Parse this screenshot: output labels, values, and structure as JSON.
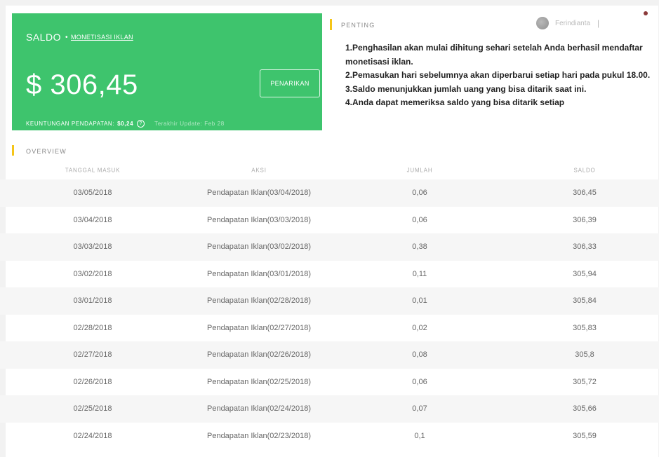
{
  "saldo": {
    "label": "SALDO",
    "bullet": "•",
    "link": "MONETISASI IKLAN",
    "amount": "$ 306,45",
    "withdraw_label": "PENARIKAN",
    "profit_label": "KEUNTUNGAN PENDAPATAN:",
    "profit_value": "$0,24",
    "updated": "Terakhir Update: Feb 28"
  },
  "notice": {
    "title": "PENTING",
    "lines": [
      "1.Penghasilan akan mulai dihitung sehari setelah Anda berhasil mendaftar monetisasi iklan.",
      "2.Pemasukan hari sebelumnya akan diperbarui setiap hari pada pukul 18.00.",
      "3.Saldo menunjukkan jumlah uang yang bisa ditarik saat ini.",
      "4.Anda dapat memeriksa saldo yang bisa ditarik setiap"
    ]
  },
  "user": {
    "name": "Ferindianta",
    "separator": "|"
  },
  "overview": {
    "title": "OVERVIEW",
    "columns": [
      "TANGGAL MASUK",
      "AKSI",
      "JUMLAH",
      "SALDO"
    ],
    "rows": [
      [
        "03/05/2018",
        "Pendapatan Iklan(03/04/2018)",
        "0,06",
        "306,45"
      ],
      [
        "03/04/2018",
        "Pendapatan Iklan(03/03/2018)",
        "0,06",
        "306,39"
      ],
      [
        "03/03/2018",
        "Pendapatan Iklan(03/02/2018)",
        "0,38",
        "306,33"
      ],
      [
        "03/02/2018",
        "Pendapatan Iklan(03/01/2018)",
        "0,11",
        "305,94"
      ],
      [
        "03/01/2018",
        "Pendapatan Iklan(02/28/2018)",
        "0,01",
        "305,84"
      ],
      [
        "02/28/2018",
        "Pendapatan Iklan(02/27/2018)",
        "0,02",
        "305,83"
      ],
      [
        "02/27/2018",
        "Pendapatan Iklan(02/26/2018)",
        "0,08",
        "305,8"
      ],
      [
        "02/26/2018",
        "Pendapatan Iklan(02/25/2018)",
        "0,06",
        "305,72"
      ],
      [
        "02/25/2018",
        "Pendapatan Iklan(02/24/2018)",
        "0,07",
        "305,66"
      ],
      [
        "02/24/2018",
        "Pendapatan Iklan(02/23/2018)",
        "0,1",
        "305,59"
      ]
    ]
  }
}
